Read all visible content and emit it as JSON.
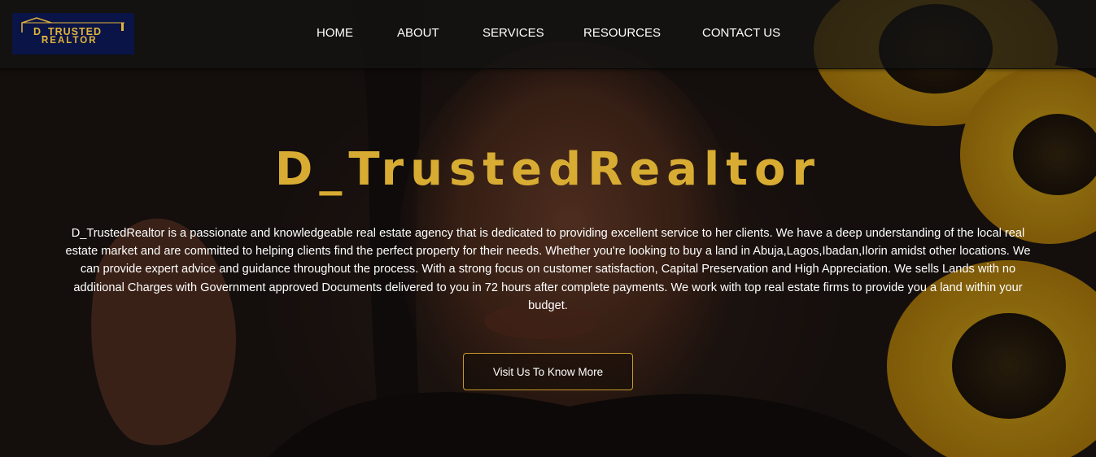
{
  "logo": {
    "line1": "D_TRUSTED",
    "line2": "REALTOR"
  },
  "nav": {
    "items": [
      {
        "label": "HOME"
      },
      {
        "label": "ABOUT"
      },
      {
        "label": "SERVICES"
      },
      {
        "label": "RESOURCES"
      },
      {
        "label": "CONTACT US"
      }
    ]
  },
  "hero": {
    "title": "D_TrustedRealtor",
    "description": "D_TrustedRealtor is a passionate and knowledgeable real estate agency that is dedicated to providing excellent service to her clients. We have a deep understanding of the local real estate market and are committed to helping clients find the perfect property for their needs. Whether you're looking to buy a land in Abuja,Lagos,Ibadan,Ilorin amidst other locations. We can provide expert advice and guidance throughout the process. With a strong focus on customer satisfaction, Capital Preservation and High Appreciation. We sells Lands with no additional Charges with Government approved Documents delivered to you in 72 hours after complete payments. We work with top real estate firms to provide you a land within your budget.",
    "cta_label": "Visit Us To Know More"
  },
  "colors": {
    "accent_gold": "#d8ac33",
    "logo_bg": "#0b1446",
    "nav_bg": "#141414"
  }
}
